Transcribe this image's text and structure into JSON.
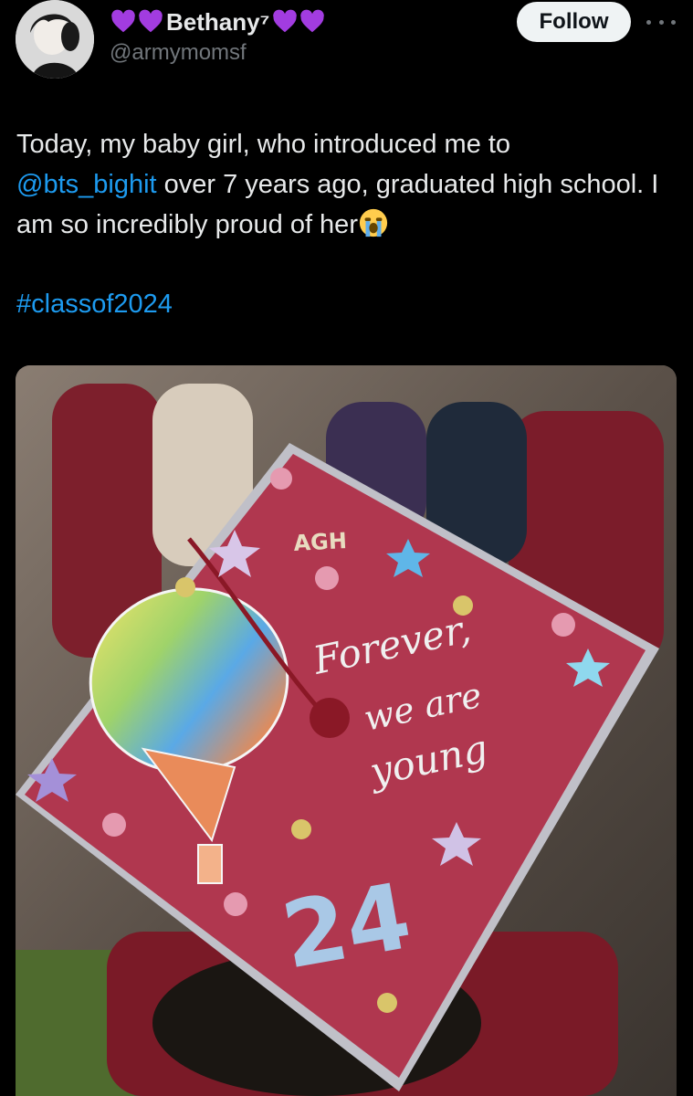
{
  "author": {
    "display_name": "Bethany⁷",
    "handle": "@armymomsf",
    "avatar_icon": "profile-photo",
    "name_emoji_icon": "purple-heart-icon",
    "heart_color": "#a23ce0"
  },
  "actions": {
    "follow_label": "Follow",
    "more_icon": "more-dots-icon"
  },
  "tweet": {
    "text_part1": "Today, my baby girl, who introduced me to",
    "mention": "@bts_bighit",
    "text_part2": " over 7 years ago, graduated high school. I am so incredibly proud of her",
    "emoji_icon": "loudly-crying-face-icon",
    "hashtag": "#classof2024",
    "link_color": "#1d9bf0"
  },
  "media": {
    "type": "photo",
    "cap_initials": "AGH",
    "cap_line1": "Forever,",
    "cap_line2": "we are",
    "cap_line3": "young",
    "cap_year": "24",
    "cap_color": "#b0374f"
  }
}
